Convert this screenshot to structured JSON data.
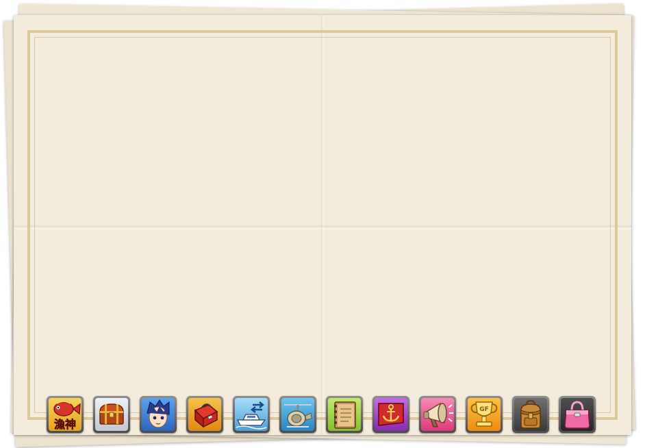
{
  "toolbar": {
    "items": [
      {
        "name": "fishing-god",
        "icon": "fishing-god-emblem-icon",
        "label": "漁神",
        "bg": "#f0c040"
      },
      {
        "name": "treasure-chest",
        "icon": "treasure-chest-icon",
        "bg": "#d8dce4"
      },
      {
        "name": "character",
        "icon": "character-portrait-icon",
        "bg": "#3d86d8"
      },
      {
        "name": "tackle-box",
        "icon": "tackle-box-icon",
        "bg": "#e8a020"
      },
      {
        "name": "boat-transfer",
        "icon": "boat-transfer-icon",
        "bg": "#7ec6ee"
      },
      {
        "name": "fishing-reel",
        "icon": "fishing-reel-icon",
        "bg": "#4aaed8"
      },
      {
        "name": "notebook",
        "icon": "notebook-icon",
        "bg": "#a6d64a"
      },
      {
        "name": "anchor-flag",
        "icon": "anchor-flag-icon",
        "bg": "#b24ad6"
      },
      {
        "name": "megaphone",
        "icon": "megaphone-icon",
        "bg": "#f06aa0"
      },
      {
        "name": "trophy",
        "icon": "trophy-cup-icon",
        "label": "GF",
        "bg": "#f5a623"
      },
      {
        "name": "backpack",
        "icon": "backpack-icon",
        "bg": "#5a5a5a"
      },
      {
        "name": "handbag",
        "icon": "handbag-icon",
        "bg": "#3a3a3a"
      }
    ]
  }
}
